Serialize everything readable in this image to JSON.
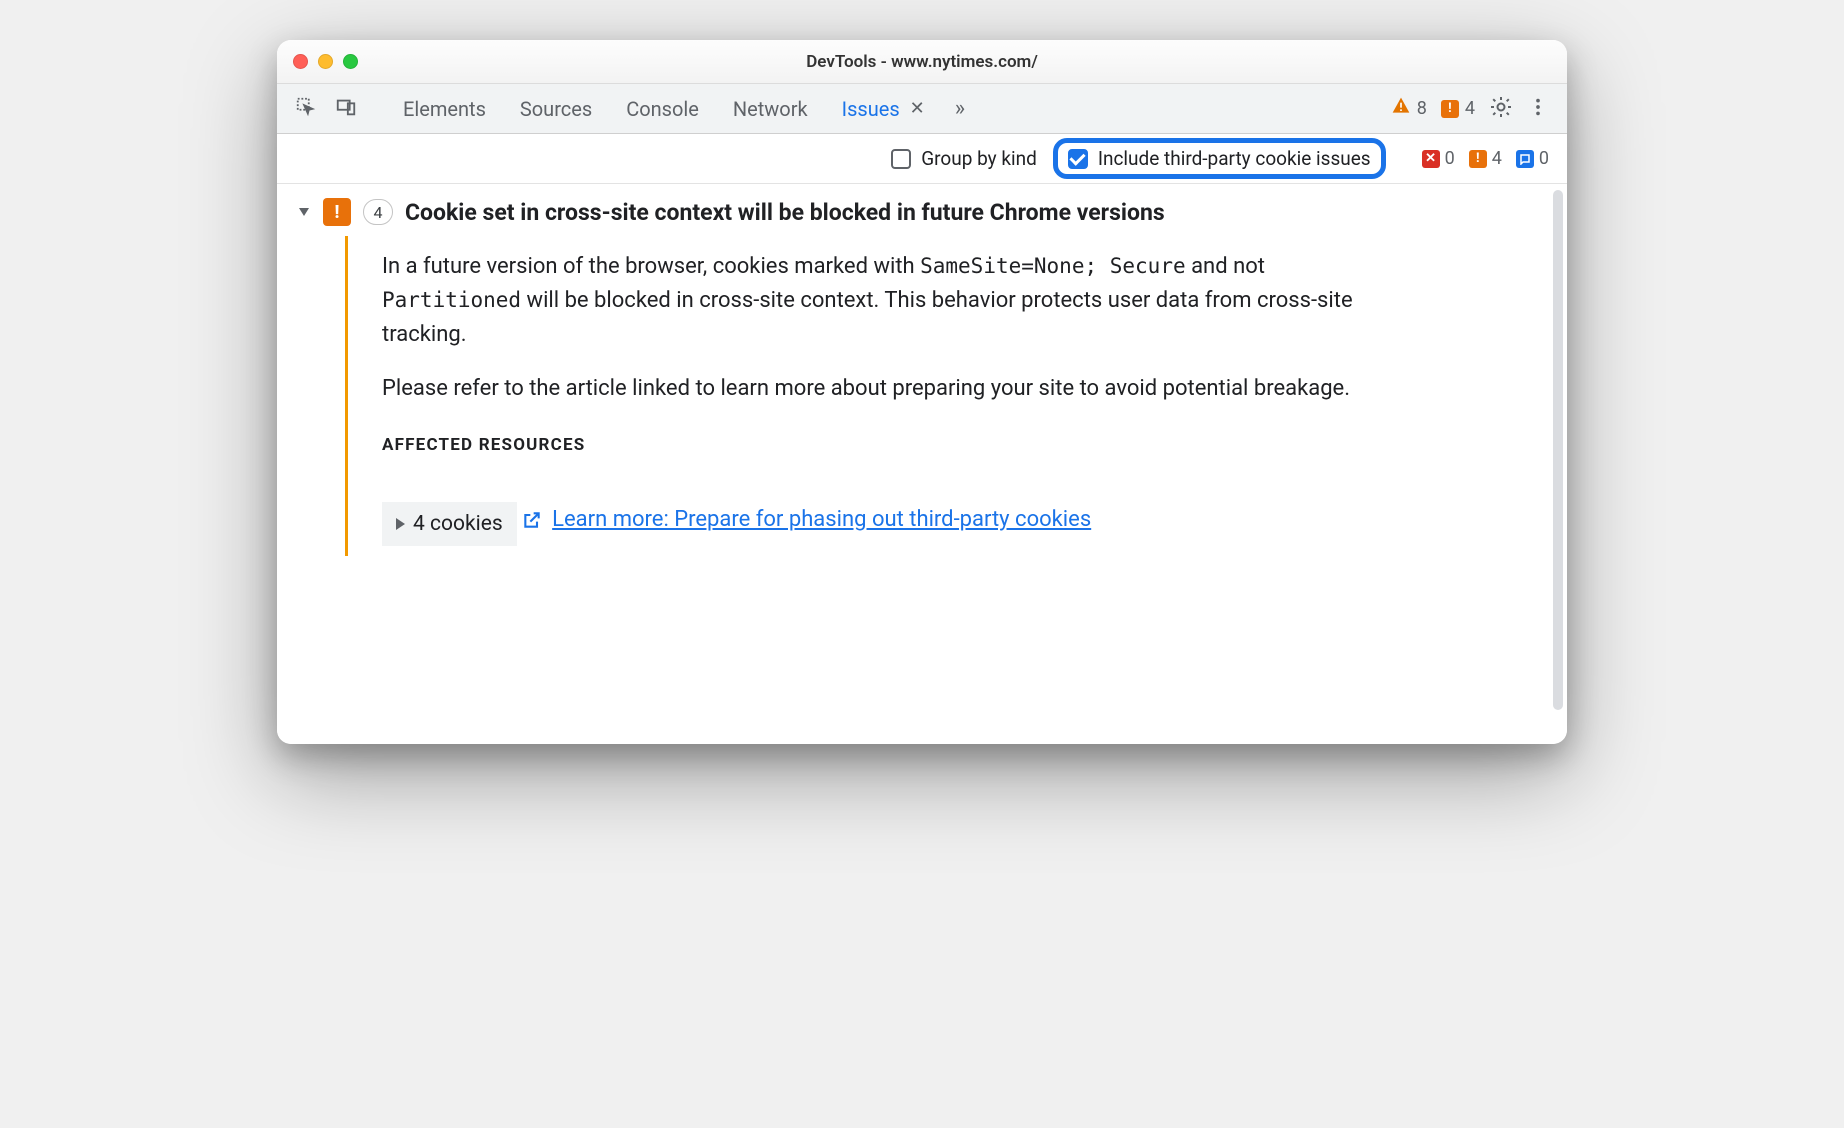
{
  "window_title": "DevTools - www.nytimes.com/",
  "tabs": {
    "elements": "Elements",
    "sources": "Sources",
    "console": "Console",
    "network": "Network",
    "issues": "Issues"
  },
  "toolbar_counts": {
    "warnings": "8",
    "errors": "4"
  },
  "filters": {
    "group_by_kind_label": "Group by kind",
    "group_by_kind_checked": false,
    "include_3p_label": "Include third-party cookie issues",
    "include_3p_checked": true
  },
  "filter_counts": {
    "errors": "0",
    "warnings": "4",
    "info": "0"
  },
  "issue": {
    "count": "4",
    "title": "Cookie set in cross-site context will be blocked in future Chrome versions",
    "para1_pre": "In a future version of the browser, cookies marked with ",
    "code1": "SameSite=None; Secure",
    "para1_mid": " and not ",
    "code2": "Partitioned",
    "para1_post": " will be blocked in cross-site context. This behavior protects user data from cross-site tracking.",
    "para2": "Please refer to the article linked to learn more about preparing your site to avoid potential breakage.",
    "affected_label": "Affected Resources",
    "resource_text": "4 cookies",
    "learn_more": "Learn more: Prepare for phasing out third-party cookies"
  }
}
